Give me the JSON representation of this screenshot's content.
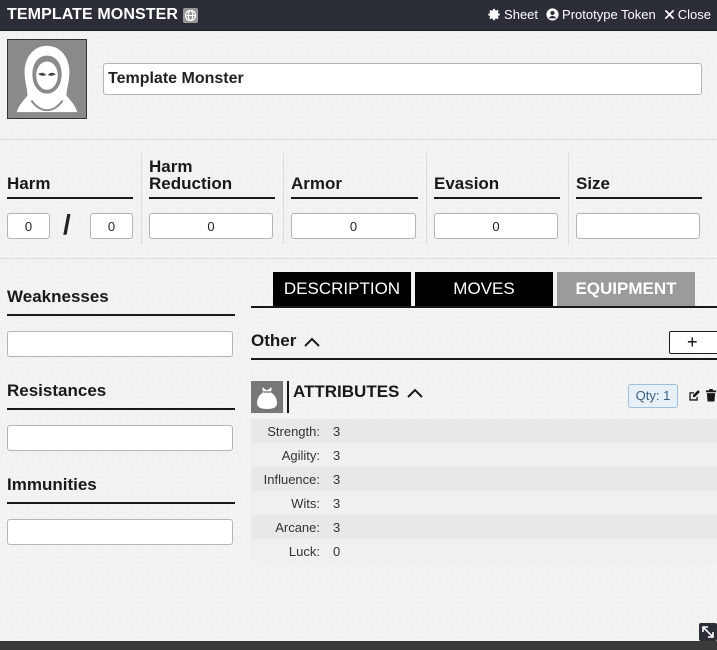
{
  "header": {
    "title": "TEMPLATE MONSTER",
    "actions": [
      {
        "label": "Sheet",
        "icon": "gear-icon"
      },
      {
        "label": "Prototype Token",
        "icon": "user-circle-icon"
      },
      {
        "label": "Close",
        "icon": "close-icon"
      }
    ]
  },
  "monster": {
    "name": "Template Monster"
  },
  "stats": {
    "harm": {
      "label": "Harm",
      "value": "0",
      "max": "0"
    },
    "harm_reduction": {
      "label": "Harm Reduction",
      "value": "0"
    },
    "armor": {
      "label": "Armor",
      "value": "0"
    },
    "evasion": {
      "label": "Evasion",
      "value": "0"
    },
    "size": {
      "label": "Size",
      "value": ""
    },
    "separator": "/"
  },
  "left": {
    "weaknesses": {
      "label": "Weaknesses",
      "value": ""
    },
    "resistances": {
      "label": "Resistances",
      "value": ""
    },
    "immunities": {
      "label": "Immunities",
      "value": ""
    }
  },
  "tabs": [
    {
      "label": "DESCRIPTION",
      "active": false
    },
    {
      "label": "MOVES",
      "active": false
    },
    {
      "label": "EQUIPMENT",
      "active": true
    }
  ],
  "equipment": {
    "section_label": "Other",
    "add_label": "+",
    "item": {
      "name": "ATTRIBUTES",
      "qty": "Qty: 1",
      "attributes": [
        {
          "name": "Strength:",
          "value": "3"
        },
        {
          "name": "Agility:",
          "value": "3"
        },
        {
          "name": "Influence:",
          "value": "3"
        },
        {
          "name": "Wits:",
          "value": "3"
        },
        {
          "name": "Arcane:",
          "value": "3"
        },
        {
          "name": "Luck:",
          "value": "0"
        }
      ]
    }
  },
  "colors": {
    "header_bg": "#2b2e37",
    "tab_bg": "#000000",
    "tab_active_bg": "#9b9b9b",
    "qty_bg": "#e8f0f7",
    "qty_text": "#3a5d7e"
  }
}
